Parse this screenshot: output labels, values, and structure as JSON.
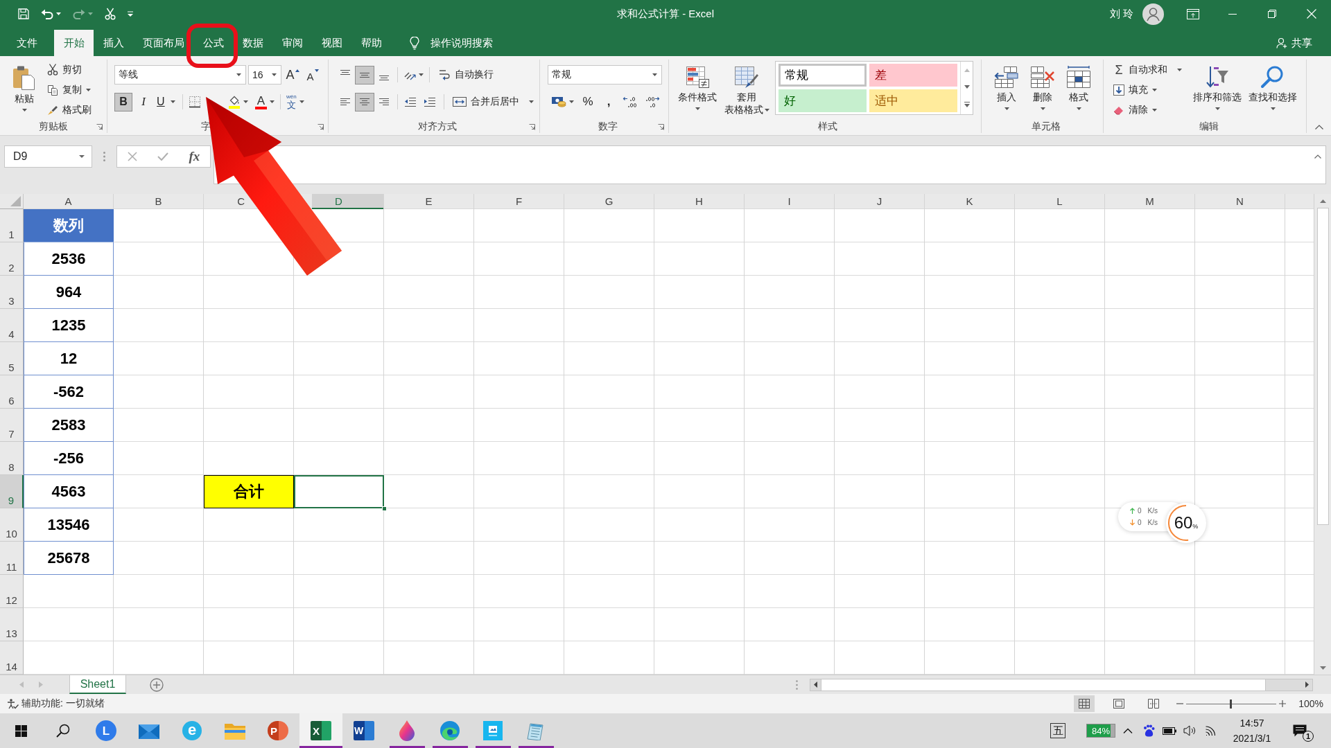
{
  "title_bar": {
    "quick_access": [
      {
        "kind": "save",
        "disabled": false
      },
      {
        "kind": "undo",
        "disabled": false
      },
      {
        "kind": "redo",
        "disabled": true
      },
      {
        "kind": "cut",
        "disabled": false
      },
      {
        "kind": "customize",
        "disabled": false
      }
    ],
    "title": "求和公式计算 - Excel",
    "user": "刘 玲"
  },
  "ribbon_tabs": [
    {
      "label": "文件",
      "selected": false
    },
    {
      "label": "开始",
      "selected": true
    },
    {
      "label": "插入",
      "selected": false
    },
    {
      "label": "页面布局",
      "selected": false
    },
    {
      "label": "公式",
      "selected": false
    },
    {
      "label": "数据",
      "selected": false
    },
    {
      "label": "审阅",
      "selected": false
    },
    {
      "label": "视图",
      "selected": false
    },
    {
      "label": "帮助",
      "selected": false
    }
  ],
  "tell_me": "操作说明搜索",
  "share": "共享",
  "ribbon": {
    "clipboard": {
      "label": "剪贴板",
      "paste": "粘贴",
      "cut": "剪切",
      "copy": "复制",
      "format_painter": "格式刷"
    },
    "font": {
      "label": "字",
      "font_name": "等线",
      "font_size": "16",
      "grow_font": "A",
      "shrink_font": "A",
      "bold": {
        "label": "B",
        "pressed": true
      },
      "italic": {
        "label": "I",
        "pressed": false
      },
      "underline": {
        "label": "U",
        "pressed": false
      },
      "font_color": "A",
      "phonetic": {
        "ruby": "wén",
        "label": "文"
      }
    },
    "alignment": {
      "label": "对齐方式",
      "vertical": [
        {
          "kind": "top",
          "pressed": false
        },
        {
          "kind": "middle",
          "pressed": true
        },
        {
          "kind": "bottom",
          "pressed": false
        }
      ],
      "horizontal": [
        {
          "kind": "left",
          "pressed": false
        },
        {
          "kind": "center",
          "pressed": true
        },
        {
          "kind": "right",
          "pressed": false
        }
      ],
      "wrap_text": "自动换行",
      "merge_center": "合并后居中"
    },
    "number": {
      "label": "数字",
      "format": "常规",
      "percent": "%",
      "comma": ","
    },
    "styles": {
      "label": "样式",
      "conditional_formatting": "条件格式",
      "format_as_table": [
        "套用",
        "表格格式"
      ],
      "gallery": [
        {
          "label": "常规",
          "kind": "normal",
          "selected": true
        },
        {
          "label": "差",
          "kind": "bad",
          "selected": false
        },
        {
          "label": "好",
          "kind": "good",
          "selected": false
        },
        {
          "label": "适中",
          "kind": "neutral",
          "selected": false
        }
      ]
    },
    "cells": {
      "label": "单元格",
      "buttons": [
        {
          "kind": "insert",
          "label": "插入"
        },
        {
          "kind": "delete",
          "label": "删除"
        },
        {
          "kind": "format",
          "label": "格式"
        }
      ]
    },
    "editing": {
      "label": "编辑",
      "autosum_symbol": "Σ",
      "autosum": "自动求和",
      "fill": "填充",
      "clear": "清除",
      "sort_filter": "排序和筛选",
      "find_select": "查找和选择"
    }
  },
  "formula_bar": {
    "name_box": "D9",
    "function_button": "fx"
  },
  "sheet": {
    "columns": [
      {
        "label": "A",
        "selected": false
      },
      {
        "label": "B",
        "selected": false
      },
      {
        "label": "C",
        "selected": false
      },
      {
        "label": "D",
        "selected": true
      },
      {
        "label": "E",
        "selected": false
      },
      {
        "label": "F",
        "selected": false
      },
      {
        "label": "G",
        "selected": false
      },
      {
        "label": "H",
        "selected": false
      },
      {
        "label": "I",
        "selected": false
      },
      {
        "label": "J",
        "selected": false
      },
      {
        "label": "K",
        "selected": false
      },
      {
        "label": "L",
        "selected": false
      },
      {
        "label": "M",
        "selected": false
      },
      {
        "label": "N",
        "selected": false
      }
    ],
    "rows": [
      {
        "label": "1",
        "selected": false,
        "cells": [
          {
            "kind": "header",
            "value": "数列",
            "selected": false
          }
        ]
      },
      {
        "label": "2",
        "selected": false,
        "cells": [
          {
            "kind": "number",
            "value": "2536",
            "selected": false
          }
        ]
      },
      {
        "label": "3",
        "selected": false,
        "cells": [
          {
            "kind": "number",
            "value": "964",
            "selected": false
          }
        ]
      },
      {
        "label": "4",
        "selected": false,
        "cells": [
          {
            "kind": "number",
            "value": "1235",
            "selected": false
          }
        ]
      },
      {
        "label": "5",
        "selected": false,
        "cells": [
          {
            "kind": "number",
            "value": "12",
            "selected": false
          }
        ]
      },
      {
        "label": "6",
        "selected": false,
        "cells": [
          {
            "kind": "number",
            "value": "-562",
            "selected": false
          }
        ]
      },
      {
        "label": "7",
        "selected": false,
        "cells": [
          {
            "kind": "number",
            "value": "2583",
            "selected": false
          }
        ]
      },
      {
        "label": "8",
        "selected": false,
        "cells": [
          {
            "kind": "number",
            "value": "-256",
            "selected": false
          }
        ]
      },
      {
        "label": "9",
        "selected": true,
        "cells": [
          {
            "kind": "number",
            "value": "4563",
            "selected": false
          },
          {
            "kind": "empty",
            "selected": false
          },
          {
            "kind": "total",
            "value": "合计",
            "selected": false
          },
          {
            "kind": "empty",
            "selected": true
          }
        ]
      },
      {
        "label": "10",
        "selected": false,
        "cells": [
          {
            "kind": "number",
            "value": "13546",
            "selected": false
          }
        ]
      },
      {
        "label": "11",
        "selected": false,
        "cells": [
          {
            "kind": "number",
            "value": "25678",
            "selected": false
          }
        ]
      },
      {
        "label": "12",
        "selected": false
      },
      {
        "label": "13",
        "selected": false
      },
      {
        "label": "14",
        "selected": false
      }
    ]
  },
  "sheet_tabs": [
    {
      "label": "Sheet1",
      "selected": true
    }
  ],
  "status_bar": {
    "text": "辅助功能: 一切就绪",
    "views": [
      {
        "kind": "normal",
        "selected": true
      },
      {
        "kind": "page_layout",
        "selected": false
      },
      {
        "kind": "page_break",
        "selected": false
      }
    ],
    "zoom": {
      "level": 0.5,
      "reading": "100%"
    }
  },
  "net_monitor": {
    "upload": "0",
    "upload_unit": "K/s",
    "download": "0",
    "download_unit": "K/s",
    "percent": "60",
    "percent_unit": "%",
    "level": 0.52
  },
  "taskbar": {
    "apps": [
      {
        "kind": "launcher",
        "glyph": "L",
        "running": false,
        "selected": false
      },
      {
        "kind": "mail",
        "running": false,
        "selected": false
      },
      {
        "kind": "e_browser",
        "glyph": "e",
        "running": false,
        "selected": false
      },
      {
        "kind": "folder",
        "running": false,
        "selected": false
      },
      {
        "kind": "slides",
        "glyph": "P",
        "running": false,
        "selected": false
      },
      {
        "kind": "spreadsheet",
        "glyph": "X",
        "running": true,
        "selected": true
      },
      {
        "kind": "document",
        "glyph": "W",
        "running": false,
        "selected": false
      },
      {
        "kind": "paint",
        "running": true,
        "selected": false
      },
      {
        "kind": "browser",
        "running": true,
        "selected": false
      },
      {
        "kind": "viewer",
        "running": true,
        "selected": false
      },
      {
        "kind": "notepad",
        "running": true,
        "selected": false
      }
    ],
    "ime": "五",
    "battery": {
      "label": "84%",
      "level": 0.84
    },
    "time": "14:57",
    "date": "2021/3/1",
    "notifications": "1"
  }
}
